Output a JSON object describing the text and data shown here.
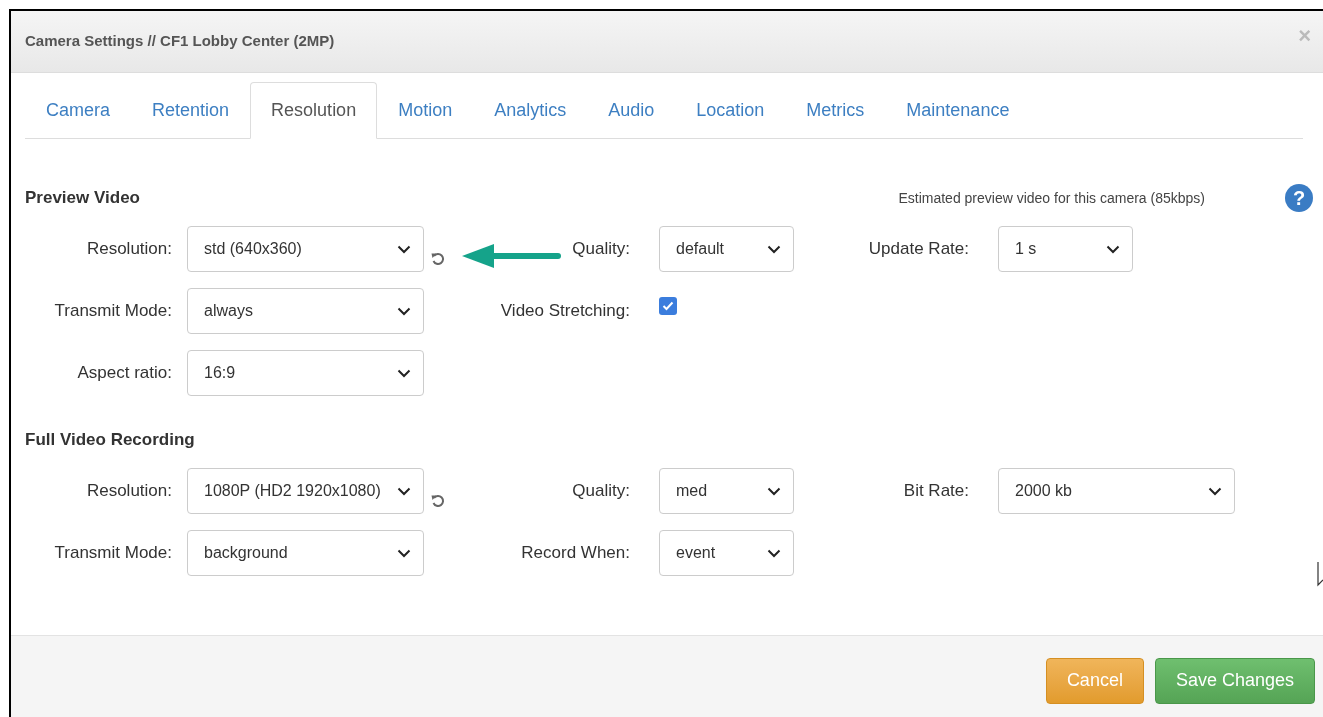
{
  "window": {
    "title": "Camera Settings // CF1 Lobby Center (2MP)",
    "close": "×"
  },
  "tabs": [
    {
      "label": "Camera",
      "selected": false
    },
    {
      "label": "Retention",
      "selected": false
    },
    {
      "label": "Resolution",
      "selected": true
    },
    {
      "label": "Motion",
      "selected": false
    },
    {
      "label": "Analytics",
      "selected": false
    },
    {
      "label": "Audio",
      "selected": false
    },
    {
      "label": "Location",
      "selected": false
    },
    {
      "label": "Metrics",
      "selected": false
    },
    {
      "label": "Maintenance",
      "selected": false
    }
  ],
  "sections": [
    {
      "title": "Preview Video",
      "note": "Estimated preview video for this camera (85kbps)",
      "help": "?",
      "rows": [
        [
          {
            "kind": "select",
            "label": "Resolution:",
            "value": "std (640x360)",
            "reset": true
          },
          {
            "kind": "select",
            "label": "Quality:",
            "value": "default"
          },
          {
            "kind": "select",
            "label": "Update Rate:",
            "value": "1 s"
          }
        ],
        [
          {
            "kind": "select",
            "label": "Transmit Mode:",
            "value": "always"
          },
          {
            "kind": "checkbox",
            "label": "Video Stretching:",
            "checked": true
          }
        ],
        [
          {
            "kind": "select",
            "label": "Aspect ratio:",
            "value": "16:9"
          }
        ]
      ]
    },
    {
      "title": "Full Video Recording",
      "rows": [
        [
          {
            "kind": "select",
            "label": "Resolution:",
            "value": "1080P (HD2 1920x1080)",
            "reset": true
          },
          {
            "kind": "select",
            "label": "Quality:",
            "value": "med"
          },
          {
            "kind": "select",
            "label": "Bit Rate:",
            "value": "2000 kb"
          }
        ],
        [
          {
            "kind": "select",
            "label": "Transmit Mode:",
            "value": "background"
          },
          {
            "kind": "select",
            "label": "Record When:",
            "value": "event"
          }
        ]
      ]
    }
  ],
  "buttons": [
    {
      "label": "Cancel",
      "kind": "warning"
    },
    {
      "label": "Save Changes",
      "kind": "success"
    }
  ]
}
